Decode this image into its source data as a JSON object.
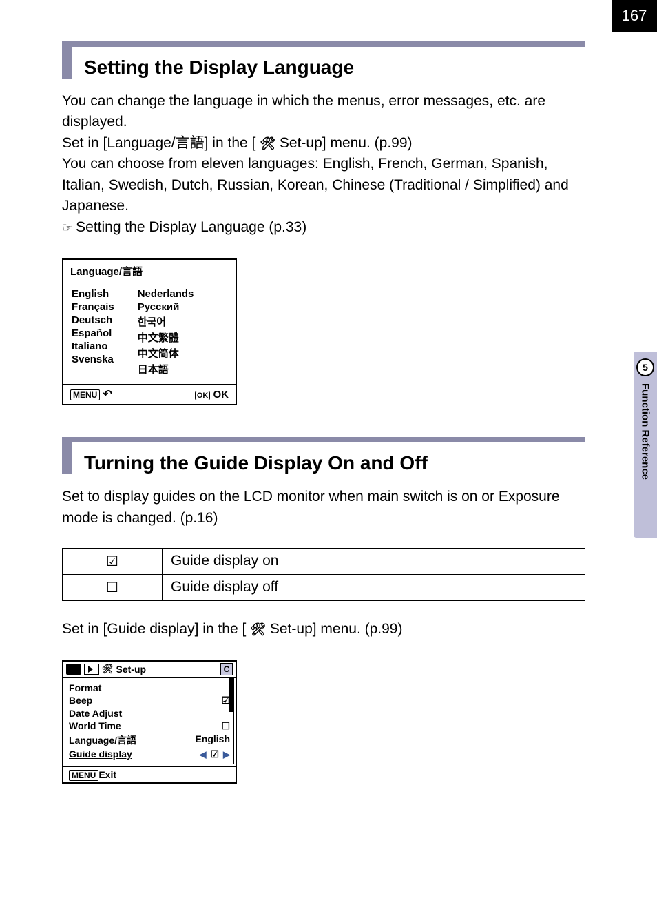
{
  "page": {
    "number": "167"
  },
  "side": {
    "chapter": "5",
    "title": "Function Reference"
  },
  "icons": {
    "wrench_glyph": "🛠"
  },
  "section1": {
    "title": "Setting the Display Language",
    "p1": "You can change the language in which the menus, error messages, etc. are displayed.",
    "p2a": "Set in [Language/言語] in the [",
    "p2b": " Set-up] menu. (p.99)",
    "p3": "You can choose from eleven languages: English, French, German, Spanish, Italian, Swedish, Dutch, Russian, Korean, Chinese (Traditional / Simplified) and Japanese.",
    "ref": "Setting the Display Language (p.33)"
  },
  "lang_menu": {
    "title": "Language/言語",
    "col1": [
      "English",
      "Français",
      "Deutsch",
      "Español",
      "Italiano",
      "Svenska"
    ],
    "col2": [
      "Nederlands",
      "Русский",
      "한국어",
      "中文繁體",
      "中文简体",
      "日本語"
    ],
    "foot": {
      "menu": "MENU",
      "ok_box": "OK",
      "ok": " OK"
    }
  },
  "section2": {
    "title": "Turning the Guide Display On and Off",
    "p1": "Set to display guides on the LCD monitor when main switch is on or Exposure mode is changed. (p.16)",
    "p2a": "Set in [Guide display] in the [",
    "p2b": " Set-up] menu. (p.99)"
  },
  "guide_table": {
    "on": "Guide display on",
    "off": "Guide display off"
  },
  "setup_menu": {
    "tab": "Set-up",
    "c": "C",
    "items": [
      {
        "label": "Format"
      },
      {
        "label": "Beep"
      },
      {
        "label": "Date Adjust"
      },
      {
        "label": "World Time"
      },
      {
        "label": "Language/言語",
        "value": "English"
      },
      {
        "label": "Guide display"
      }
    ],
    "foot": {
      "menu": "MENU",
      "exit": "Exit"
    }
  }
}
